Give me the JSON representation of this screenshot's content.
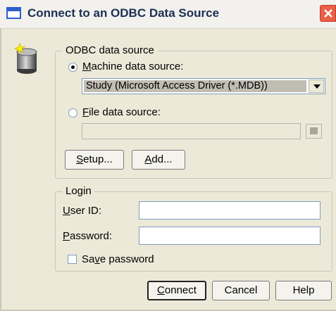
{
  "window": {
    "title": "Connect to an ODBC Data Source",
    "title_icon": "window-icon",
    "close_icon": "close-icon",
    "colors": {
      "face": "#ece9d8",
      "title_text": "#1c2f52",
      "close": "#e9604a",
      "selection": "#c0bdb3"
    }
  },
  "datasource": {
    "legend": "ODBC data source",
    "icon": "database-icon",
    "machine": {
      "accel": "M",
      "rest": "achine data source:",
      "selected": true
    },
    "machine_value": "Study (Microsoft Access Driver (*.MDB))",
    "file": {
      "accel": "F",
      "rest": "ile data source:",
      "selected": false
    },
    "file_value": "",
    "setup": {
      "accel": "S",
      "rest": "etup..."
    },
    "add": {
      "accel": "A",
      "rest": "dd..."
    }
  },
  "login": {
    "legend": "Login",
    "userid": {
      "accel": "U",
      "rest": "ser ID:"
    },
    "userid_value": "",
    "password": {
      "accel": "P",
      "rest": "assword:"
    },
    "password_value": "",
    "save": {
      "pre": "Sa",
      "accel": "v",
      "rest": "e password",
      "checked": false
    }
  },
  "buttons": {
    "connect": {
      "accel": "C",
      "rest": "onnect"
    },
    "cancel": "Cancel",
    "help": "Help"
  }
}
